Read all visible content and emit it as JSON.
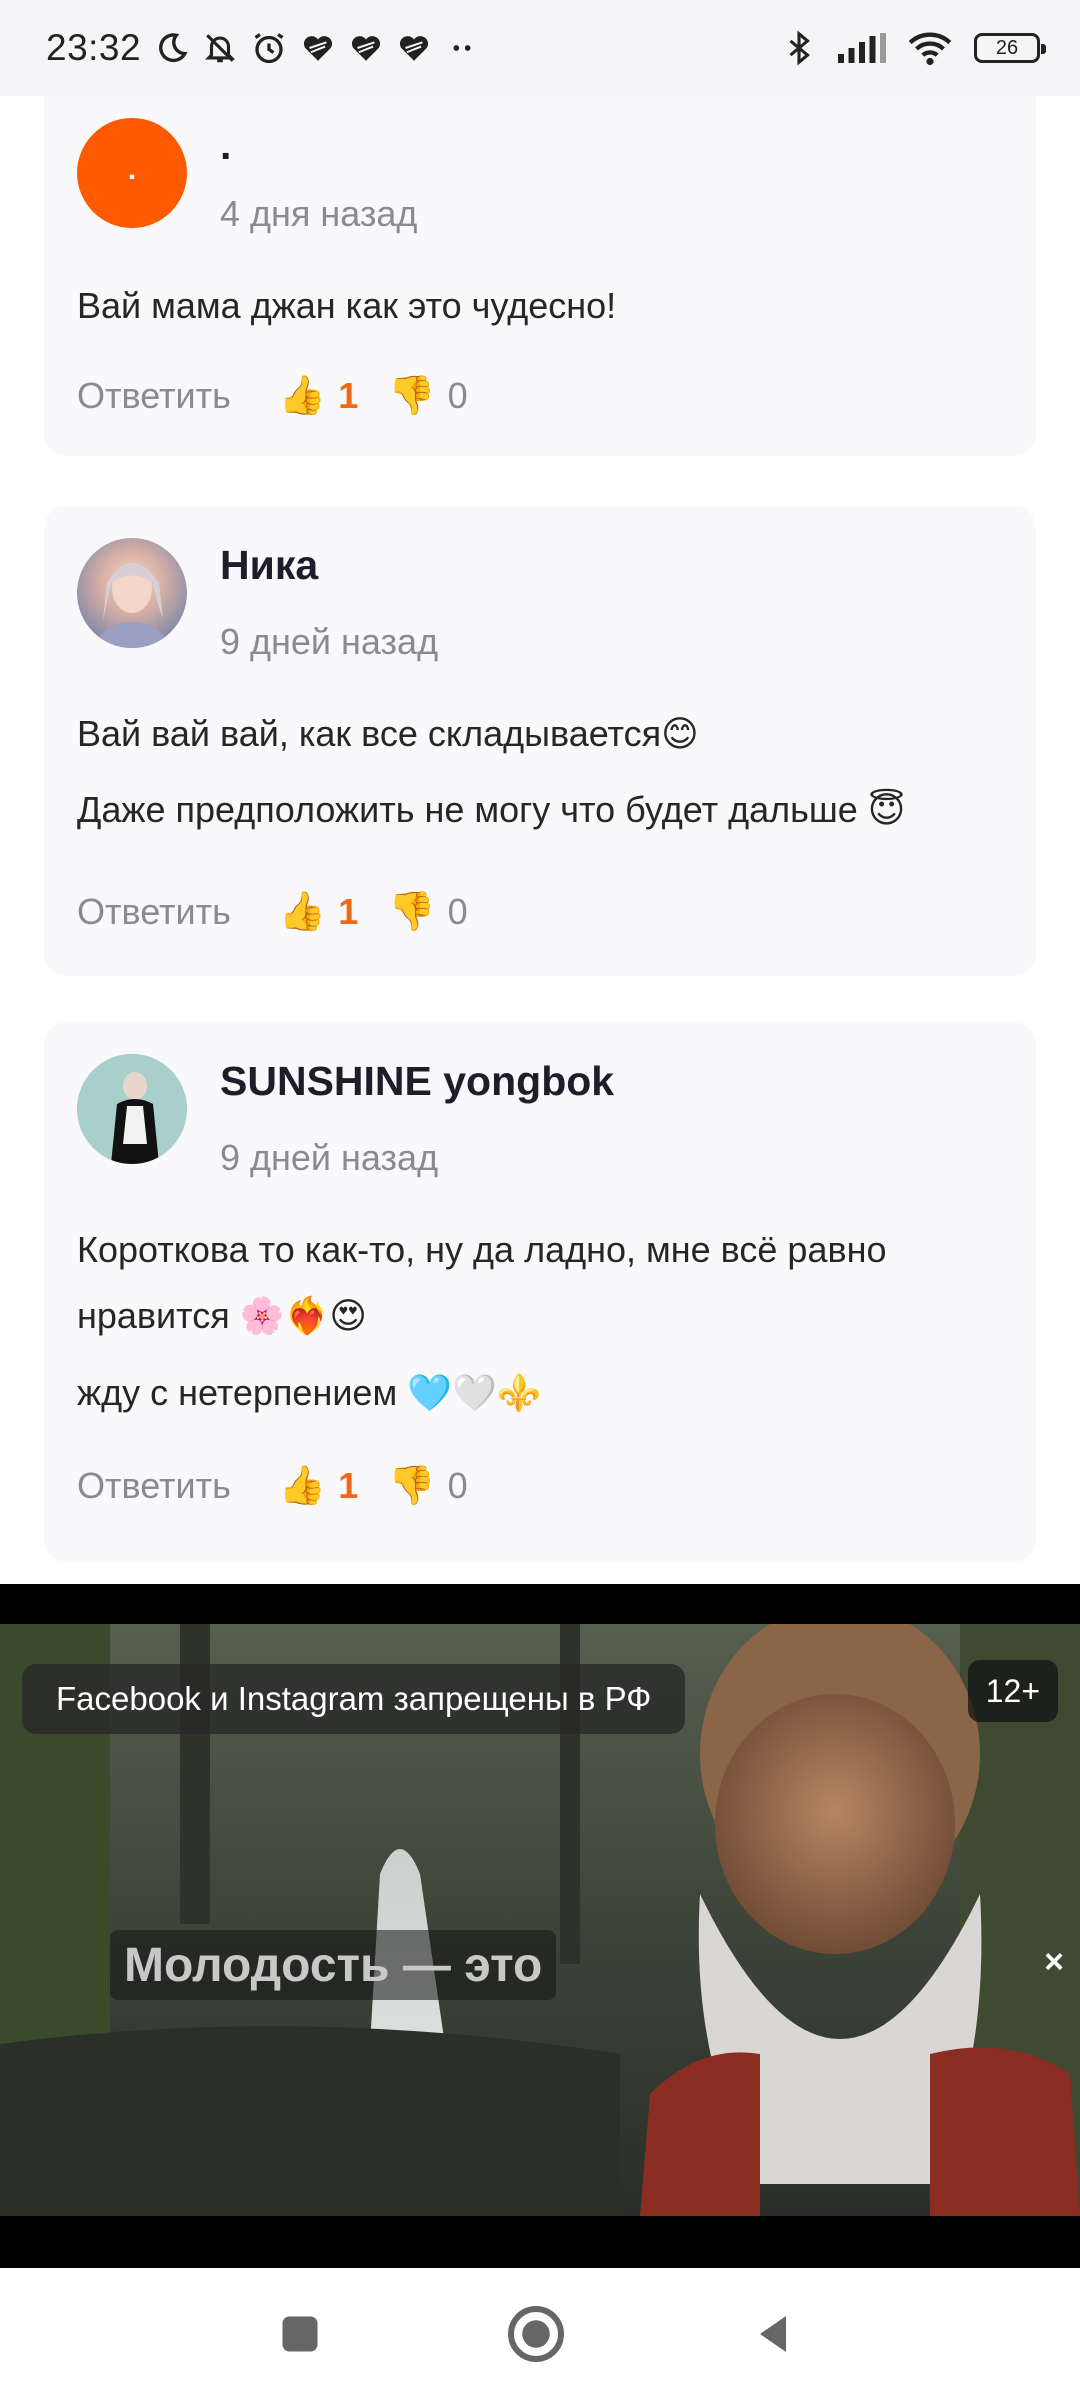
{
  "status_bar": {
    "time": "23:32",
    "battery": "26",
    "icons": [
      "moon-icon",
      "bell-off-icon",
      "alarm-icon",
      "heart-icon",
      "heart-icon",
      "heart-icon",
      "more-dots-icon",
      "bluetooth-icon",
      "signal-icon",
      "wifi-icon",
      "battery-icon"
    ]
  },
  "comments": [
    {
      "author": ".",
      "avatar_letter": ".",
      "avatar_color": "#ff5a00",
      "date": "4 дня назад",
      "lines": [
        "Вай мама джан как это чудесно!"
      ],
      "reply_label": "Ответить",
      "likes": "1",
      "dislikes": "0"
    },
    {
      "author": "Ника",
      "date": "9 дней назад",
      "lines": [
        "Вай вай вай, как все складывается😊",
        "Даже предположить не могу что будет дальше 😇"
      ],
      "reply_label": "Ответить",
      "likes": "1",
      "dislikes": "0"
    },
    {
      "author": "SUNSHINE yongbok",
      "date": "9 дней назад",
      "lines": [
        "Короткова то как-то, ну да ладно, мне всё равно",
        "нравится 🌸❤️‍🔥😍",
        "жду с нетерпением 🩵🤍⚜️"
      ],
      "reply_label": "Ответить",
      "likes": "1",
      "dislikes": "0"
    }
  ],
  "ad": {
    "banner": "Facebook и Instagram запрещены в РФ",
    "age_rating": "12+",
    "caption": "Молодость — это",
    "close": "×"
  },
  "colors": {
    "accent": "#f06a16",
    "card_bg": "#f9f9fb",
    "muted_text": "#8a8a91"
  }
}
